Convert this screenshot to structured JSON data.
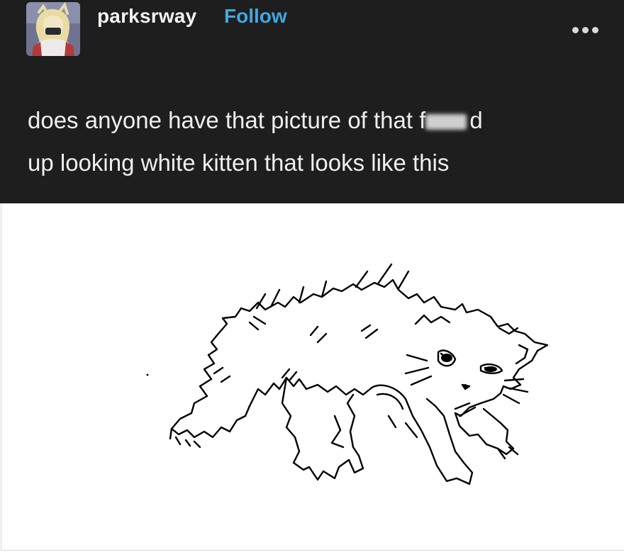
{
  "author": {
    "username": "parksrway",
    "follow_label": "Follow",
    "avatar_icon": "avatar-illustration-icon"
  },
  "menu": {
    "icon": "more-horizontal-icon"
  },
  "post": {
    "line1_before": "does anyone have that picture of that f",
    "line1_after": "d",
    "line2": "up looking white kitten that looks like this"
  },
  "image": {
    "icon": "cat-drawing-icon"
  },
  "colors": {
    "header_bg": "#1e1e1e",
    "text": "#efefef",
    "follow": "#3fa8e0",
    "image_bg": "#ffffff"
  }
}
